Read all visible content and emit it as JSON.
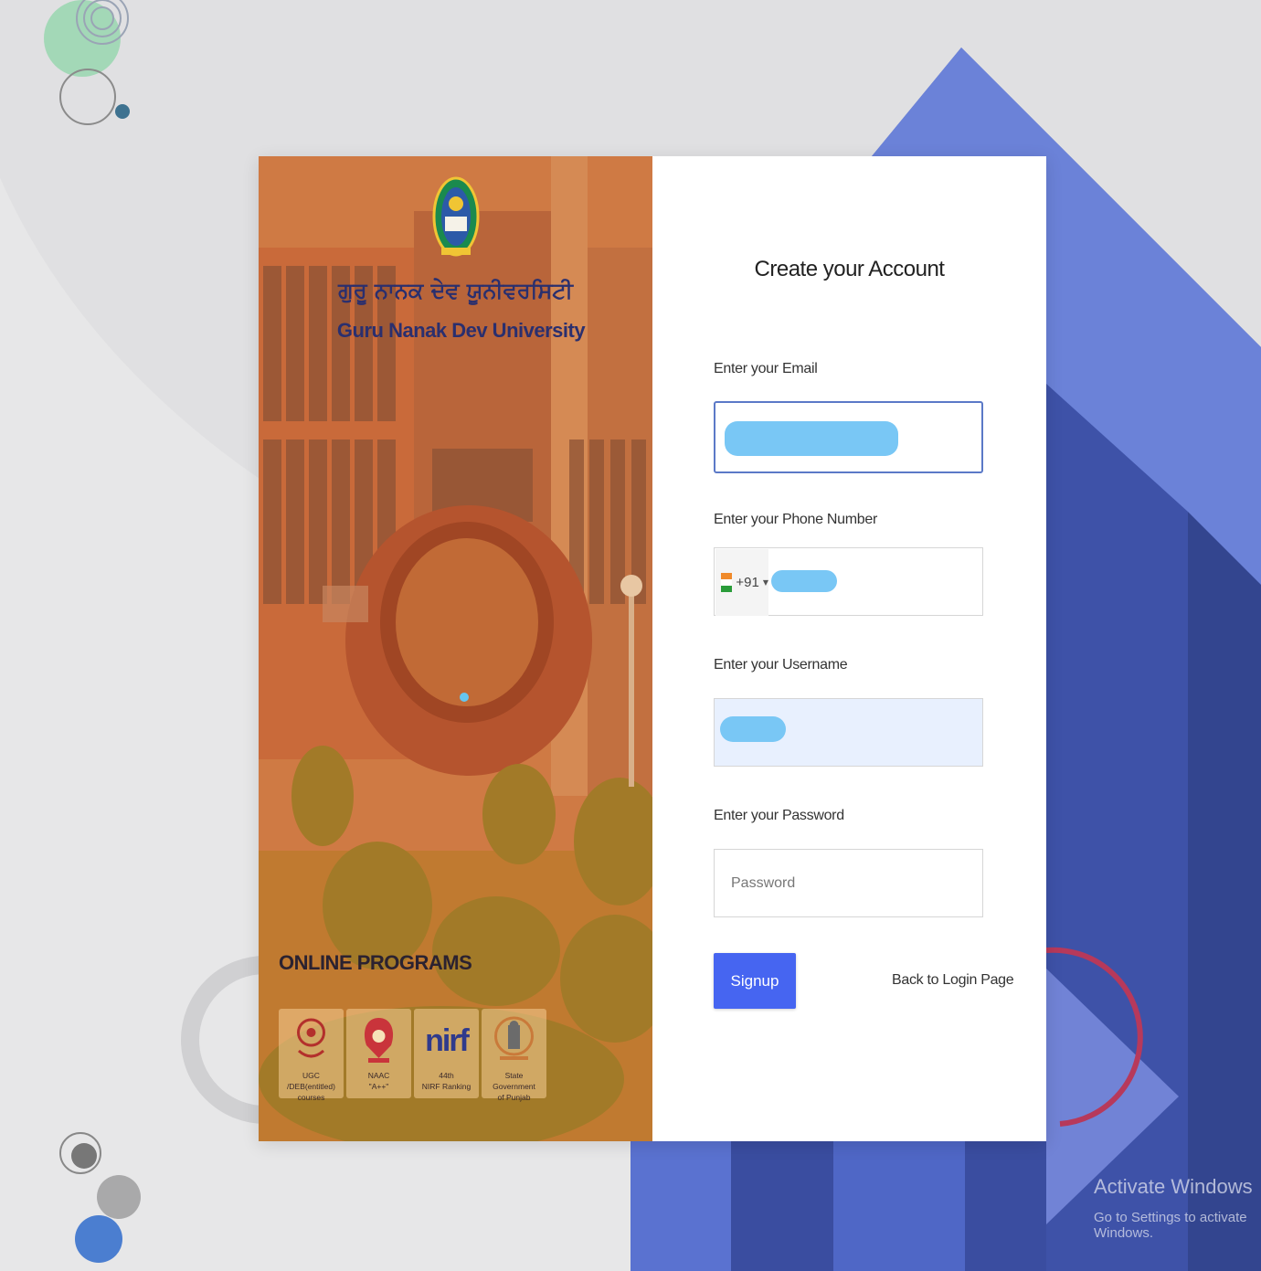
{
  "university": {
    "name_gurmukhi": "ਗੁਰੂ ਨਾਨਕ ਦੇਵ ਯੂਨੀਵਰਸਿਟੀ",
    "name": "Guru Nanak Dev University",
    "logo_icon": "university-seal-icon"
  },
  "programs": {
    "heading": "ONLINE PROGRAMS",
    "badges": [
      {
        "icon": "ugc-logo-icon",
        "line1": "UGC",
        "line2": "/DEB(entitled) courses"
      },
      {
        "icon": "naac-logo-icon",
        "line1": "NAAC",
        "line2": "\"A++\""
      },
      {
        "icon": "nirf-logo-icon",
        "logo_text": "nirf",
        "line1": "44th",
        "line2": "NIRF Ranking"
      },
      {
        "icon": "punjab-emblem-icon",
        "line1": "State Government",
        "line2": "of Punjab"
      }
    ]
  },
  "form": {
    "title": "Create your Account",
    "email": {
      "label": "Enter your Email",
      "value": ""
    },
    "phone": {
      "label": "Enter your Phone Number",
      "country_code": "+91",
      "value": ""
    },
    "username": {
      "label": "Enter your Username",
      "value": ""
    },
    "password": {
      "label": "Enter your Password",
      "placeholder": "Password",
      "value": ""
    },
    "signup_label": "Signup",
    "back_link": "Back to Login Page"
  },
  "watermark": {
    "title": "Activate Windows",
    "subtitle": "Go to Settings to activate Windows."
  },
  "colors": {
    "accent": "#4665f1",
    "bg_blue": "#4d63c4",
    "panel_overlay": "#e9803e",
    "redaction": "#79c7f5"
  }
}
